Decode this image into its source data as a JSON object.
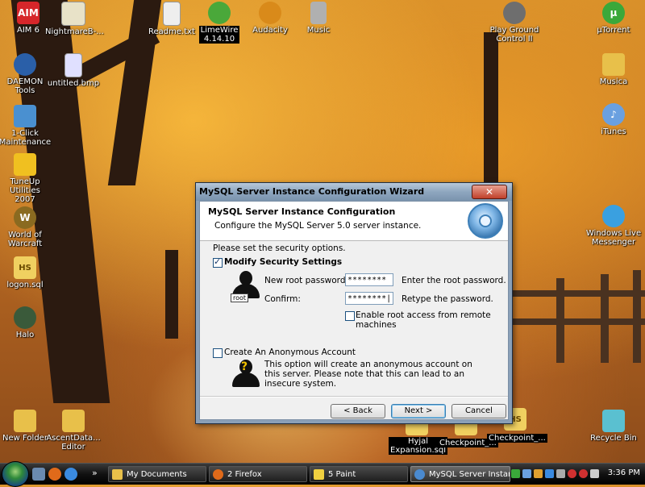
{
  "desktop": {
    "icons": [
      {
        "label": "AIM 6",
        "icon": "aim-icon",
        "color": "#d6262a"
      },
      {
        "label": "NightmareB-...",
        "icon": "document-icon",
        "color": "#e8e2c8"
      },
      {
        "label": "Readme.txt",
        "icon": "text-file-icon",
        "color": "#eeeeee"
      },
      {
        "label": "LimeWire\n4.14.10",
        "icon": "limewire-icon",
        "color": "#4aa83a"
      },
      {
        "label": "Audacity",
        "icon": "audacity-icon",
        "color": "#d98a1a"
      },
      {
        "label": "Music",
        "icon": "music-folder-icon",
        "color": "#b0b0b0"
      },
      {
        "label": "Play Ground\nControl II",
        "icon": "playground-icon",
        "color": "#6e6e6e"
      },
      {
        "label": "µTorrent",
        "icon": "utorrent-icon",
        "color": "#3aa83a"
      },
      {
        "label": "DAEMON Tools",
        "icon": "daemon-tools-icon",
        "color": "#2a5fa8"
      },
      {
        "label": "untitled.bmp",
        "icon": "bitmap-icon",
        "color": "#e0e0ff"
      },
      {
        "label": "Musica",
        "icon": "folder-icon",
        "color": "#e8c04a"
      },
      {
        "label": "1-Click\nMaintenance",
        "icon": "maintenance-icon",
        "color": "#4a90d0"
      },
      {
        "label": "iTunes",
        "icon": "itunes-icon",
        "color": "#6aa0e0"
      },
      {
        "label": "TuneUp Utilities\n2007",
        "icon": "tuneup-icon",
        "color": "#f0c020"
      },
      {
        "label": "World of\nWarcraft",
        "icon": "wow-icon",
        "color": "#8a6a20"
      },
      {
        "label": "Windows Live\nMessenger",
        "icon": "messenger-icon",
        "color": "#3aa0e0"
      },
      {
        "label": "logon.sql",
        "icon": "sql-file-icon",
        "color": "#f0d060"
      },
      {
        "label": "Halo",
        "icon": "halo-icon",
        "color": "#3a5a3a"
      },
      {
        "label": "New Folder",
        "icon": "folder-icon",
        "color": "#e8c04a"
      },
      {
        "label": "AscentData...\nEditor",
        "icon": "folder-icon",
        "color": "#e8c04a"
      },
      {
        "label": "Hyjal\nExpansion.sql",
        "icon": "sql-file-icon",
        "color": "#f0d060"
      },
      {
        "label": "Checkpoint_...",
        "icon": "sql-file-icon",
        "color": "#f0d060"
      },
      {
        "label": "Checkpoint_...",
        "icon": "sql-file-icon",
        "color": "#f0d060"
      },
      {
        "label": "Recycle Bin",
        "icon": "recycle-bin-icon",
        "color": "#5ac0d0"
      }
    ]
  },
  "dialog": {
    "title": "MySQL Server Instance Configuration Wizard",
    "close_symbol": "✕",
    "header_title": "MySQL Server Instance Configuration",
    "header_subtitle": "Configure the MySQL Server 5.0 server instance.",
    "prompt": "Please set the security options.",
    "modify_security": {
      "label": "Modify Security Settings",
      "checked": true
    },
    "root_tag": "root",
    "new_password": {
      "label": "New root password:",
      "value": "********",
      "hint": "Enter the root password."
    },
    "confirm": {
      "label": "Confirm:",
      "value": "********|",
      "hint": "Retype the password."
    },
    "remote_access": {
      "label": "Enable root access from remote machines",
      "checked": false
    },
    "anonymous": {
      "label": "Create An Anonymous Account",
      "checked": false,
      "description": "This option will create an anonymous account on this server. Please note that this can lead to an insecure system."
    },
    "question_mark": "?",
    "buttons": {
      "back": "< Back",
      "next": "Next >",
      "cancel": "Cancel"
    }
  },
  "taskbar": {
    "chevron": "»",
    "tasks": [
      {
        "label": "My Documents",
        "icon": "folder-icon",
        "color": "#e8c04a"
      },
      {
        "label": "2 Firefox",
        "icon": "firefox-icon",
        "color": "#e06a1a"
      },
      {
        "label": "5 Paint",
        "icon": "paint-icon",
        "color": "#f0d040"
      },
      {
        "label": "MySQL Server Instanc...",
        "icon": "mysql-wizard-icon",
        "color": "#4a8ad0"
      }
    ],
    "clock": "3:36 PM"
  }
}
